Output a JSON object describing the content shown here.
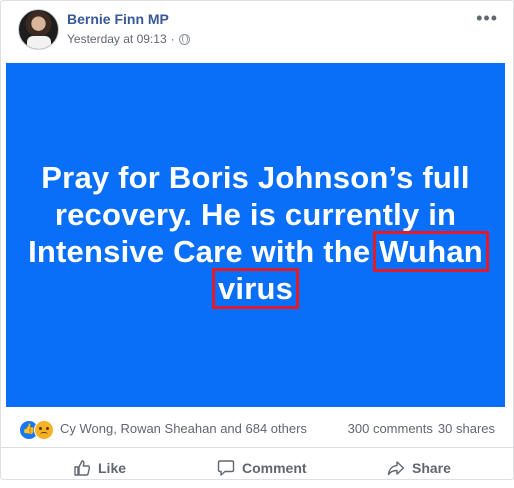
{
  "post": {
    "author": "Bernie Finn MP",
    "timestamp": "Yesterday at 09:13",
    "separator": "·",
    "more_icon": "ellipsis-icon",
    "privacy_icon": "globe-icon"
  },
  "banner": {
    "background": "#0a6ff8",
    "text_color": "#ffffff",
    "highlight_color": "#e21b2b",
    "line1": "Pray for Boris Johnson’s full",
    "line2": "recovery. He is currently in",
    "line3_prefix": "Intensive Care with the",
    "highlight_1": "Wuhan",
    "highlight_2": "virus"
  },
  "reactions": {
    "icons": [
      "like-reaction-icon",
      "sad-reaction-icon"
    ],
    "names": "Cy Wong, Rowan Sheahan and 684 others",
    "comments": "300 comments",
    "shares": "30 shares"
  },
  "actions": {
    "like": "Like",
    "comment": "Comment",
    "share": "Share"
  }
}
